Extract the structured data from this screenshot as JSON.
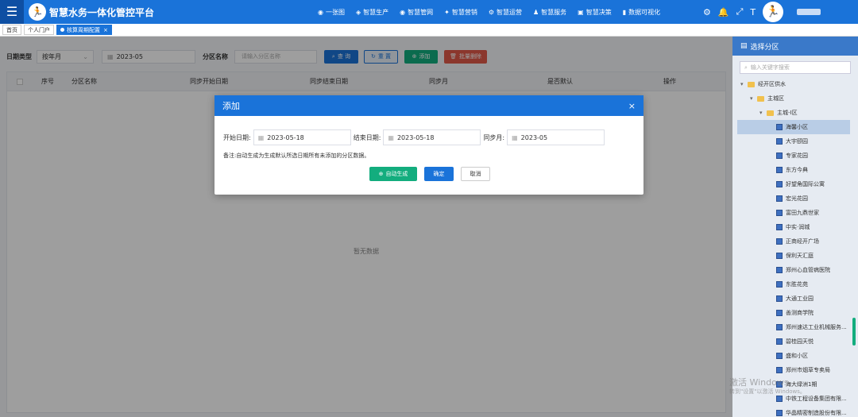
{
  "app": {
    "title": "智慧水务一体化管控平台",
    "logo_glyph": "🏃"
  },
  "nav": [
    {
      "icon": "globe-icon",
      "glyph": "◉",
      "label": "一张图"
    },
    {
      "icon": "production-icon",
      "glyph": "◈",
      "label": "智慧生产"
    },
    {
      "icon": "network-icon",
      "glyph": "◉",
      "label": "智慧管网"
    },
    {
      "icon": "marketing-icon",
      "glyph": "✦",
      "label": "智慧营销"
    },
    {
      "icon": "operation-icon",
      "glyph": "⚙",
      "label": "智慧运营"
    },
    {
      "icon": "service-icon",
      "glyph": "♟",
      "label": "智慧服务"
    },
    {
      "icon": "decision-icon",
      "glyph": "▣",
      "label": "智慧决策"
    },
    {
      "icon": "chart-icon",
      "glyph": "▮",
      "label": "数据可视化"
    }
  ],
  "tabs": [
    {
      "label": "首页"
    },
    {
      "label": "个人门户"
    },
    {
      "label": "核算周期配置",
      "close": "×"
    }
  ],
  "filter": {
    "date_type_label": "日期类型",
    "date_type_value": "按年月",
    "date_value": "2023-05",
    "area_label": "分区名称",
    "area_placeholder": "请输入分区名称",
    "query": "查 询",
    "reset": "重 置",
    "add": "添加",
    "batch_delete": "批量删除"
  },
  "table": {
    "columns": [
      "序号",
      "分区名称",
      "同步开始日期",
      "同步结束日期",
      "同步月",
      "是否默认",
      "操作"
    ],
    "empty": "暂无数据"
  },
  "modal": {
    "title": "添加",
    "close": "×",
    "start_label": "开始日期:",
    "start_value": "2023-05-18",
    "end_label": "结束日期:",
    "end_value": "2023-05-18",
    "month_label": "同步月:",
    "month_value": "2023-05",
    "note": "备注:自动生成为生成默认所选日期所有未添加的分区数据。",
    "auto_btn": "自动生成",
    "ok_btn": "确定",
    "cancel_btn": "取消"
  },
  "sidebar": {
    "title": "选择分区",
    "search_placeholder": "输入关键字搜索",
    "tree": [
      {
        "label": "经开区供水",
        "level": 0,
        "type": "folder"
      },
      {
        "label": "主城区",
        "level": 1,
        "type": "folder"
      },
      {
        "label": "主城-Ⅰ区",
        "level": 2,
        "type": "folder"
      },
      {
        "label": "海馨小区",
        "level": 3,
        "type": "building",
        "selected": true
      },
      {
        "label": "大宇颐园",
        "level": 3,
        "type": "building"
      },
      {
        "label": "专家花园",
        "level": 3,
        "type": "building"
      },
      {
        "label": "东方今典",
        "level": 3,
        "type": "building"
      },
      {
        "label": "好望角国际公寓",
        "level": 3,
        "type": "building"
      },
      {
        "label": "宏光花园",
        "level": 3,
        "type": "building"
      },
      {
        "label": "富田九鼎世家",
        "level": 3,
        "type": "building"
      },
      {
        "label": "中实·润城",
        "level": 3,
        "type": "building"
      },
      {
        "label": "正商经开广场",
        "level": 3,
        "type": "building"
      },
      {
        "label": "保利天汇庭",
        "level": 3,
        "type": "building"
      },
      {
        "label": "郑州心血管病医院",
        "level": 3,
        "type": "building"
      },
      {
        "label": "东胜花苑",
        "level": 3,
        "type": "building"
      },
      {
        "label": "大通工业园",
        "level": 3,
        "type": "building"
      },
      {
        "label": "善测商学院",
        "level": 3,
        "type": "building"
      },
      {
        "label": "郑州速达工业机械服务...",
        "level": 3,
        "type": "building"
      },
      {
        "label": "碧桂园天悦",
        "level": 3,
        "type": "building"
      },
      {
        "label": "盛和小区",
        "level": 3,
        "type": "building"
      },
      {
        "label": "郑州市烟草专卖局",
        "level": 3,
        "type": "building"
      },
      {
        "label": "海大绿洲1期",
        "level": 3,
        "type": "building"
      },
      {
        "label": "中铁工程设备集团有限...",
        "level": 3,
        "type": "building"
      },
      {
        "label": "华晶精密制造股份有限...",
        "level": 3,
        "type": "building"
      }
    ]
  },
  "watermark": {
    "line1": "激活 Windows",
    "line2": "转到\"设置\"以激活 Windows。"
  }
}
